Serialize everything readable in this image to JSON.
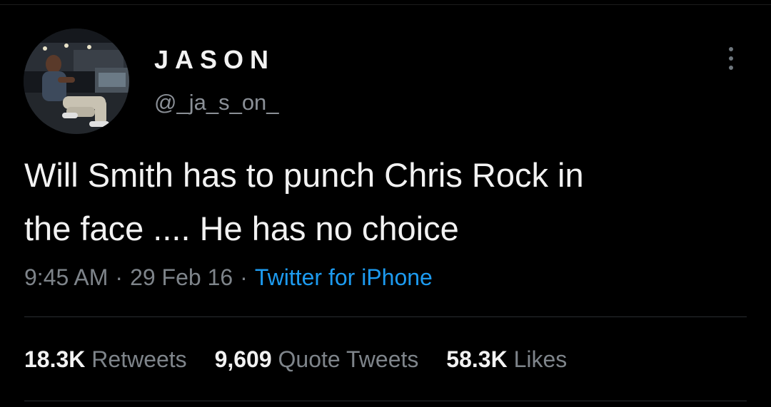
{
  "tweet": {
    "author": {
      "display_name": "JASON",
      "handle": "@_ja_s_on_"
    },
    "text_lines": [
      "Will Smith has to punch Chris Rock in",
      "the face .... He has no choice"
    ],
    "time": "9:45 AM",
    "date": "29 Feb 16",
    "separator": "·",
    "source": "Twitter for iPhone",
    "stats": {
      "retweets_count": "18.3K",
      "retweets_label": "Retweets",
      "quotes_count": "9,609",
      "quotes_label": "Quote Tweets",
      "likes_count": "58.3K",
      "likes_label": "Likes"
    }
  },
  "icons": {
    "more": "more-options-icon",
    "avatar": "profile-photo"
  },
  "colors": {
    "background": "#000000",
    "text": "#f2f2f2",
    "secondary_text": "#7e848a",
    "link": "#1d9bf0",
    "divider": "#2a2d31"
  }
}
